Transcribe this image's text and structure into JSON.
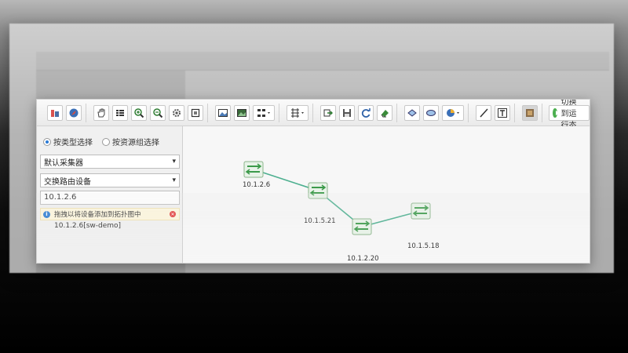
{
  "toolbar": {
    "switch_label": "切换到运行态"
  },
  "sidebar": {
    "radio_by_type": "按类型选择",
    "radio_by_group": "按资源组选择",
    "collector_select": "默认采集器",
    "device_type_select": "交换路由设备",
    "search_value": "10.1.2.6",
    "hint_text": "拖拽以将设备添加到拓扑图中",
    "result_item": "10.1.2.6[sw-demo]"
  },
  "topology": {
    "nodes": [
      {
        "label": "10.1.2.6"
      },
      {
        "label": "10.1.5.21"
      },
      {
        "label": "10.1.2.20"
      },
      {
        "label": "10.1.5.18"
      }
    ],
    "link_color": "#4caf8f"
  },
  "colors": {
    "accent": "#2a7ad5",
    "switch_green": "#4caf50",
    "close_red": "#e23b3b"
  }
}
